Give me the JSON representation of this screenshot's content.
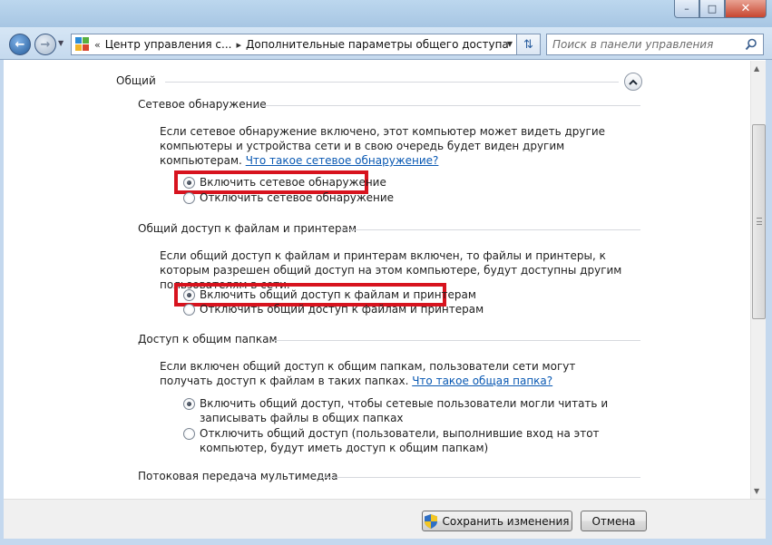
{
  "window": {
    "minimize_glyph": "–",
    "maximize_glyph": "□",
    "close_glyph": "✕"
  },
  "address_bar": {
    "separator": "«",
    "crumbs": [
      "Центр управления с...",
      "Дополнительные параметры общего доступа"
    ],
    "crumb_arrow": "▸",
    "search_placeholder": "Поиск в панели управления"
  },
  "profile": {
    "title": "Общий"
  },
  "sections": {
    "discovery": {
      "title": "Сетевое обнаружение",
      "desc": "Если сетевое обнаружение включено, этот компьютер может видеть другие компьютеры и устройства сети и в свою очередь будет виден другим компьютерам. ",
      "link": "Что такое сетевое обнаружение?",
      "option_on": "Включить сетевое обнаружение",
      "option_off": "Отключить сетевое обнаружение",
      "selected": "on"
    },
    "file_sharing": {
      "title": "Общий доступ к файлам и принтерам",
      "desc": "Если общий доступ к файлам и принтерам включен, то файлы и принтеры, к которым разрешен общий доступ на этом компьютере, будут доступны другим пользователям в сети.",
      "option_on": "Включить общий доступ к файлам и принтерам",
      "option_off": "Отключить общий доступ к файлам и принтерам",
      "selected": "on"
    },
    "public_folders": {
      "title": "Доступ к общим папкам",
      "desc": "Если включен общий доступ к общим папкам, пользователи сети могут получать доступ к файлам в таких папках. ",
      "link": "Что такое общая папка?",
      "option_on": "Включить общий доступ, чтобы сетевые пользователи могли читать и записывать файлы в общих папках",
      "option_off": "Отключить общий доступ (пользователи, выполнившие вход на этот компьютер, будут иметь доступ к общим папкам)",
      "selected": "on"
    },
    "media_streaming": {
      "title": "Потоковая передача мультимедиа"
    }
  },
  "footer": {
    "save_label": "Сохранить изменения",
    "cancel_label": "Отмена"
  },
  "colors": {
    "highlight": "#d7131e",
    "link": "#0a59b3"
  }
}
